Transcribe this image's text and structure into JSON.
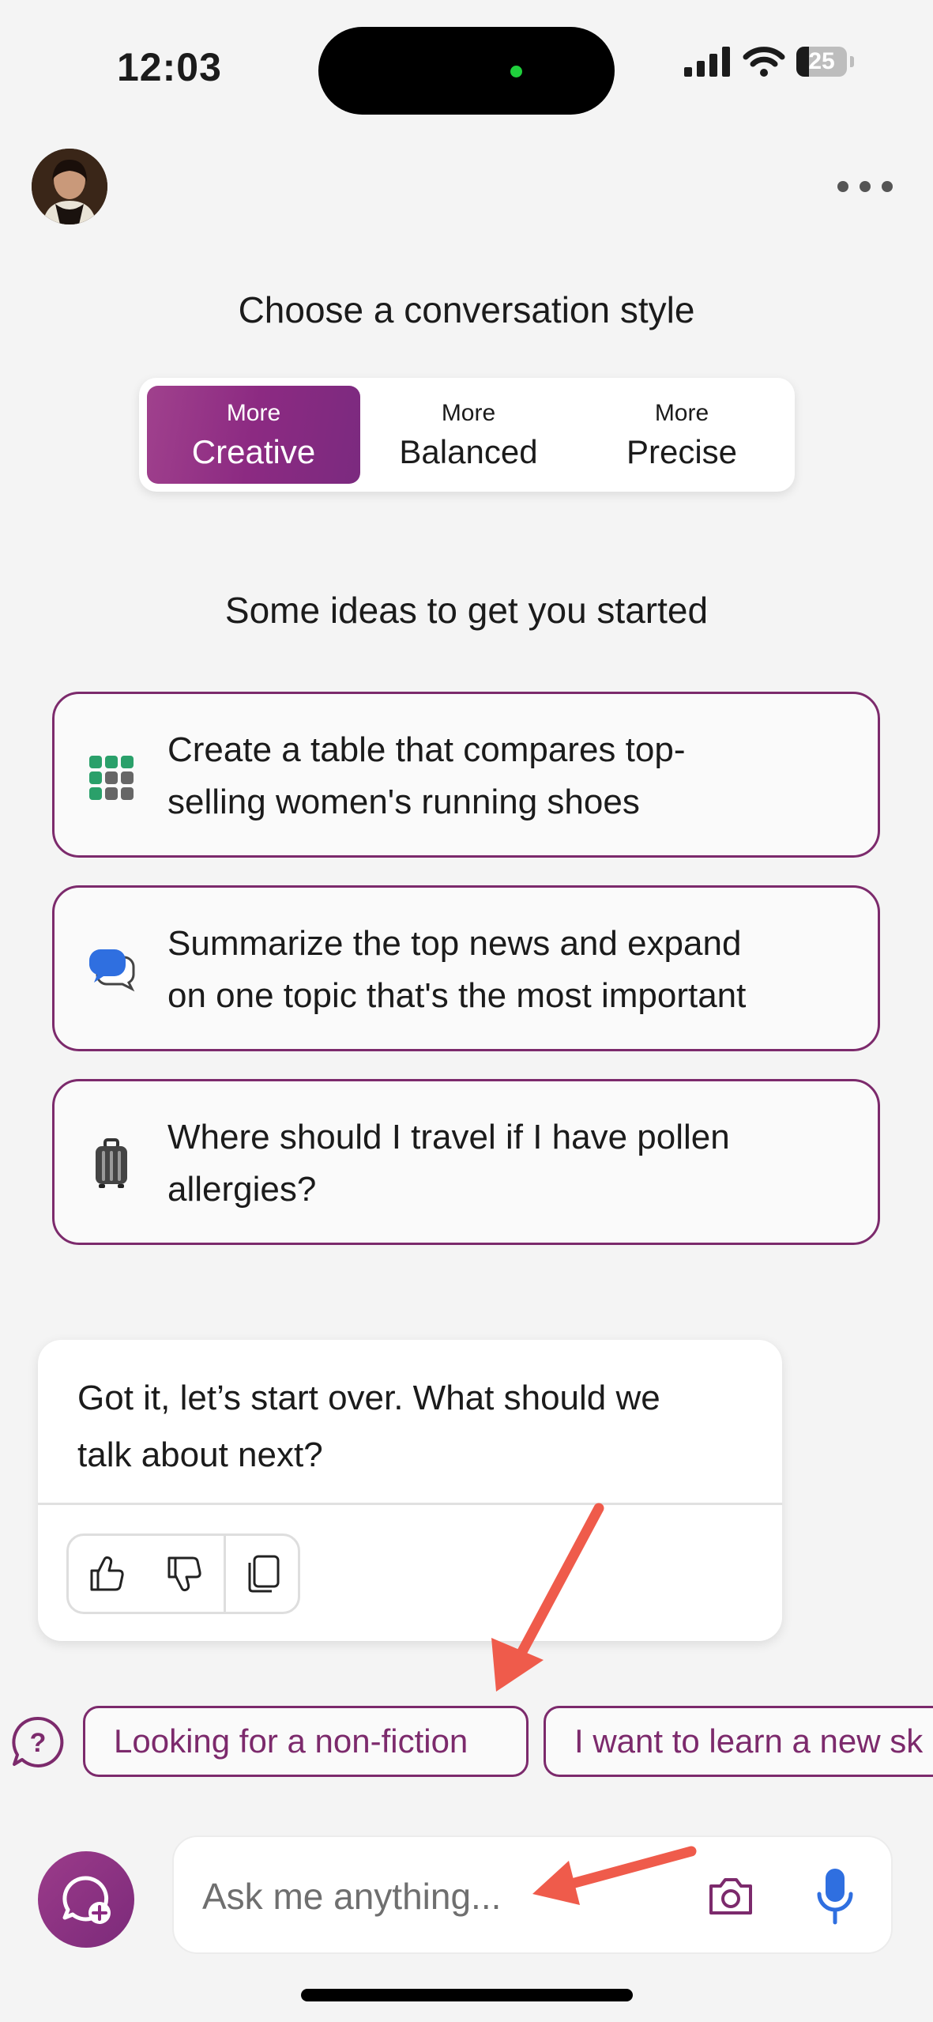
{
  "status_bar": {
    "time": "12:03",
    "battery": "25"
  },
  "style_picker": {
    "title": "Choose a conversation style",
    "options": [
      {
        "small": "More",
        "label": "Creative",
        "selected": true
      },
      {
        "small": "More",
        "label": "Balanced",
        "selected": false
      },
      {
        "small": "More",
        "label": "Precise",
        "selected": false
      }
    ]
  },
  "ideas": {
    "title": "Some ideas to get you started",
    "items": [
      {
        "icon": "table-grid-icon",
        "line1": "Create a table that compares top-",
        "line2": "selling women's running shoes"
      },
      {
        "icon": "speech-bubbles-icon",
        "line1": "Summarize the top news and expand",
        "line2": "on one topic that's the most important"
      },
      {
        "icon": "luggage-icon",
        "line1": "Where should I travel if I have pollen",
        "line2": "allergies?"
      }
    ]
  },
  "message": {
    "line1": "Got it, let’s start over. What should we",
    "line2": "talk about next?"
  },
  "suggestions": [
    "Looking for a non-fiction",
    "I want to learn a new sk"
  ],
  "composer": {
    "placeholder": "Ask me anything..."
  },
  "colors": {
    "accent": "#7c2a6c",
    "gradient_start": "#a0418d",
    "mic": "#2f6fe0",
    "annotation_arrow": "#ef5b4b"
  }
}
